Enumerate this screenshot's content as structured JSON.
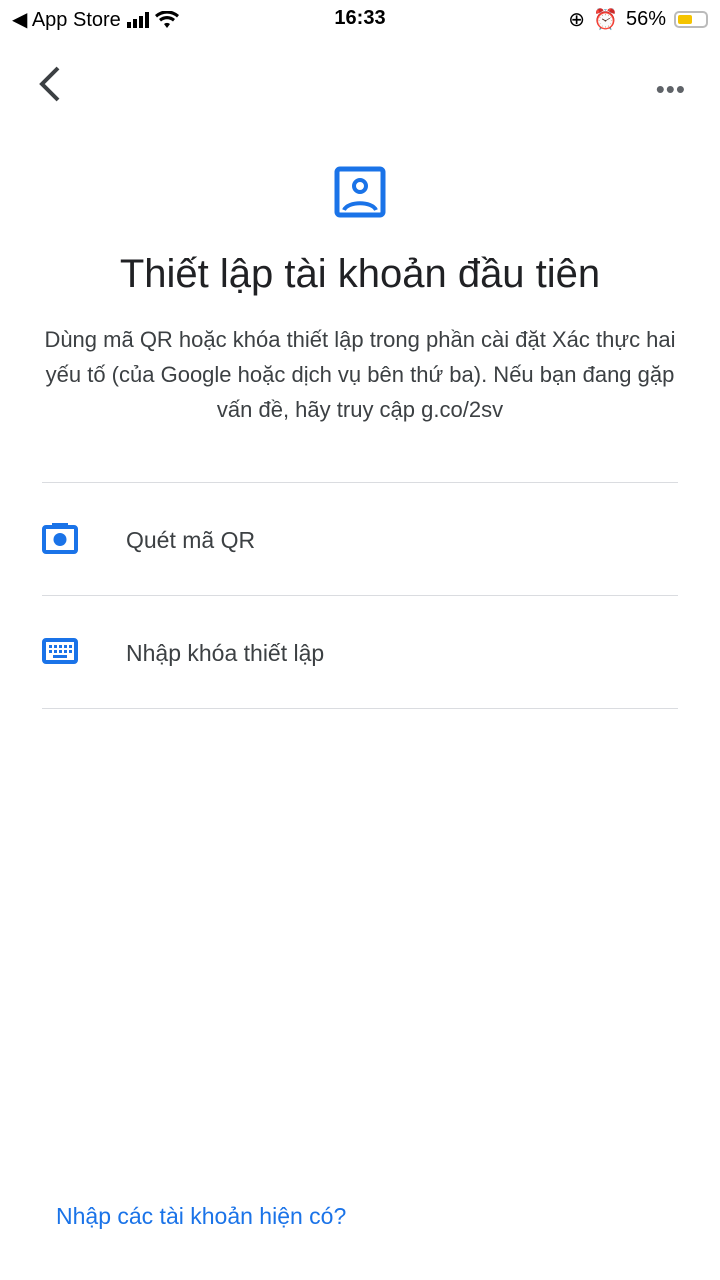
{
  "status_bar": {
    "back_app": "◀ App Store",
    "time": "16:33",
    "battery": "56%",
    "battery_level": 0.56
  },
  "page": {
    "title": "Thiết lập tài khoản đầu tiên",
    "description": "Dùng mã QR hoặc khóa thiết lập trong phần cài đặt Xác thực hai yếu tố (của Google hoặc dịch vụ bên thứ ba). Nếu bạn đang gặp vấn đề, hãy truy cập g.co/2sv"
  },
  "options": [
    {
      "label": "Quét mã QR",
      "icon": "camera-icon"
    },
    {
      "label": "Nhập khóa thiết lập",
      "icon": "keyboard-icon"
    }
  ],
  "footer": {
    "import_link": "Nhập các tài khoản hiện có?"
  },
  "colors": {
    "accent": "#1a73e8"
  }
}
